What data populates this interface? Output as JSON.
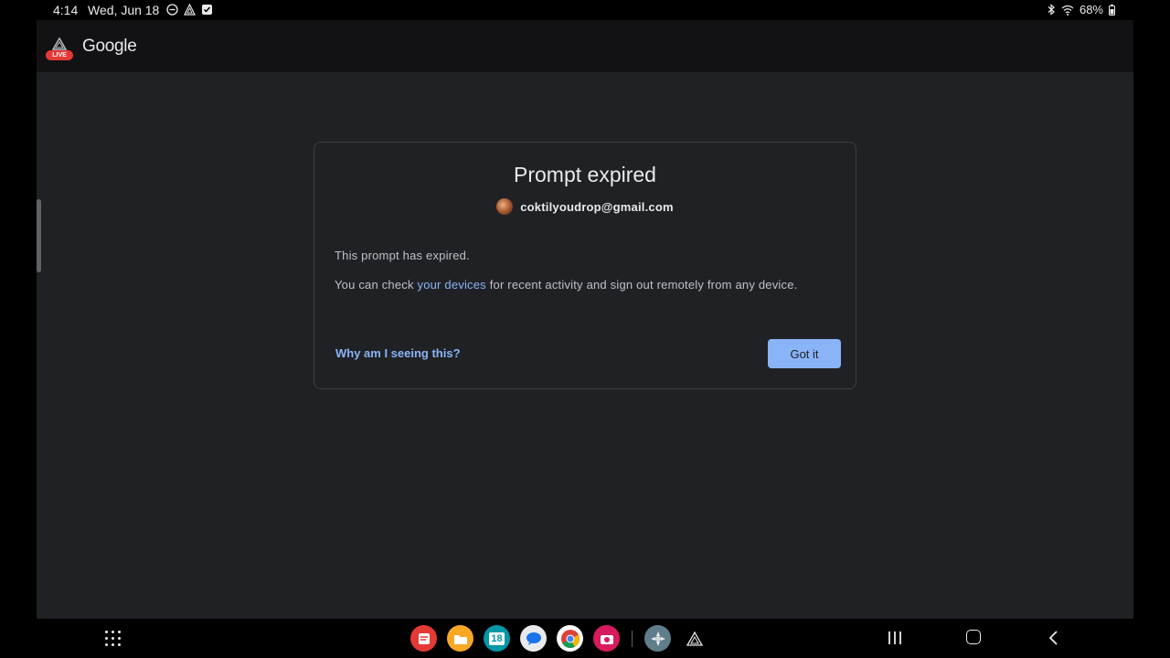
{
  "status_bar": {
    "time": "4:14",
    "date": "Wed, Jun 18",
    "battery": "68%",
    "icons": [
      "do-not-disturb-icon",
      "app-notification-icon",
      "checkbox-notification-icon",
      "bluetooth-icon",
      "wifi-icon",
      "battery-icon"
    ]
  },
  "app_header": {
    "badge": "LIVE",
    "title": "Google"
  },
  "dialog": {
    "title": "Prompt expired",
    "account_email": "coktilyoudrop@gmail.com",
    "message": "This prompt has expired.",
    "devices_prefix": "You can check ",
    "devices_link": "your devices",
    "devices_suffix": " for recent activity and sign out remotely from any device.",
    "why_link": "Why am I seeing this?",
    "confirm_button": "Got it"
  },
  "dock": {
    "apps": [
      "notes-app-icon",
      "files-app-icon",
      "calendar-app-icon",
      "messages-app-icon",
      "chrome-app-icon",
      "camera-app-icon",
      "game-app-icon",
      "triangle-app-icon"
    ],
    "calendar_day": "18"
  },
  "colors": {
    "background": "#202124",
    "link": "#8ab4f8",
    "button": "#8ab4f8",
    "live_badge": "#e53935"
  }
}
